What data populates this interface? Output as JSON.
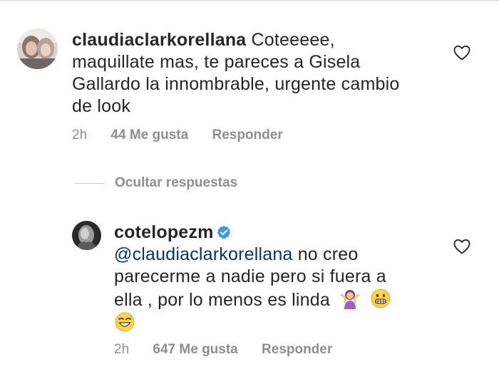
{
  "comment": {
    "username": "claudiaclarkorellana",
    "text_line1": " Coteeeee,",
    "text_line2": "maquillate mas, te pareces a Gisela",
    "text_line3": "Gallardo la innombrable, urgente cambio",
    "text_line4": "de look",
    "time": "2h",
    "likes": "44 Me gusta",
    "reply": "Responder"
  },
  "hide_replies": "Ocultar respuestas",
  "reply_comment": {
    "username": "cotelopezm",
    "mention": "@claudiaclarkorellana",
    "text_line1_rest": " no creo",
    "text_line2": "parecerme a nadie pero si fuera a",
    "text_line3": "ella , por lo menos es linda",
    "time": "2h",
    "likes": "647 Me gusta",
    "reply": "Responder"
  },
  "icons": {
    "heart": "heart-outline-icon",
    "verified": "verified-badge-icon",
    "emoji_shrug": "woman-shrugging-emoji",
    "emoji_grimace": "grimacing-face-emoji",
    "emoji_sweat": "grinning-sweat-emoji"
  },
  "colors": {
    "mention": "#00376b",
    "verified": "#3897f0",
    "muted": "#8e8e8e"
  }
}
